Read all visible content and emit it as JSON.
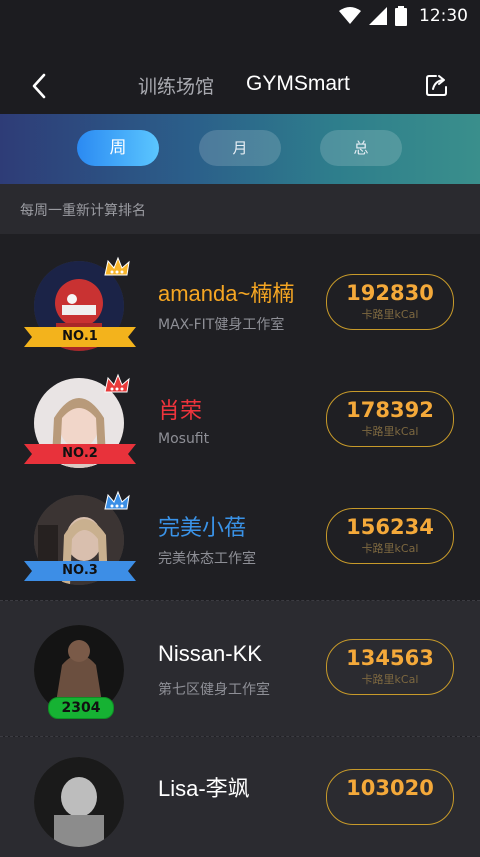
{
  "status_bar": {
    "time": "12:30"
  },
  "nav": {
    "tab_venue": "训练场馆",
    "tab_gymsmart": "GYMSmart"
  },
  "period": {
    "week": "周",
    "month": "月",
    "total": "总"
  },
  "rank_note": "每周一重新计算排名",
  "rankings": [
    {
      "name": "amanda~楠楠",
      "studio": "MAX-FIT健身工作室",
      "score": "192830",
      "unit": "卡路里kCal",
      "badge": "NO.1",
      "name_color": "#f5a623",
      "ribbon_color": "#f3b31c",
      "crown_color": "#f7b52a"
    },
    {
      "name": "肖荣",
      "studio": "Mosufit",
      "score": "178392",
      "unit": "卡路里kCal",
      "badge": "NO.2",
      "name_color": "#f0343c",
      "ribbon_color": "#e8323b",
      "crown_color": "#e83a3a"
    },
    {
      "name": "完美小蓓",
      "studio": "完美体态工作室",
      "score": "156234",
      "unit": "卡路里kCal",
      "badge": "NO.3",
      "name_color": "#3a93e8",
      "ribbon_color": "#3d8ee6",
      "crown_color": "#3b8fe6"
    },
    {
      "name": "Nissan-KK",
      "studio": "第七区健身工作室",
      "score": "134563",
      "unit": "卡路里kCal",
      "badge": "2304",
      "name_color": "#ffffff"
    },
    {
      "name": "Lisa-李飒",
      "studio": "",
      "score": "103020",
      "unit": "",
      "badge": "",
      "name_color": "#ffffff"
    }
  ]
}
